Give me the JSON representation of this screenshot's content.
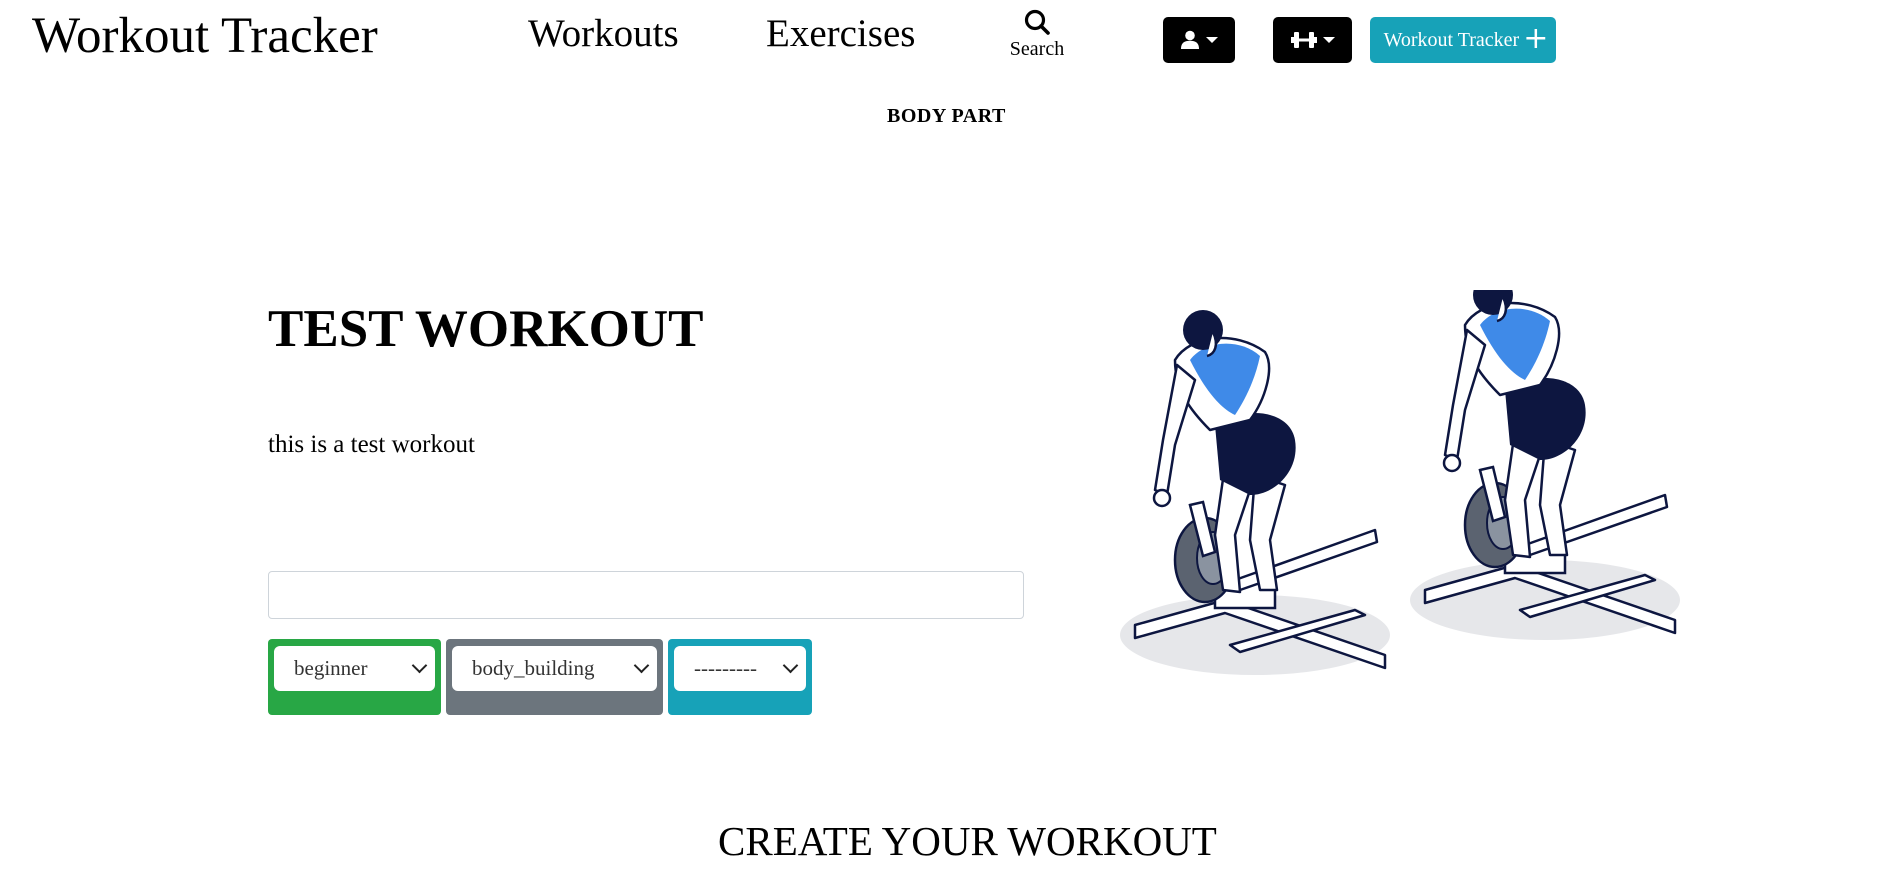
{
  "navbar": {
    "brand": "Workout Tracker",
    "links": [
      {
        "label": "Workouts"
      },
      {
        "label": "Exercises"
      }
    ],
    "search_label": "Search",
    "add_button_label": "Workout Tracker"
  },
  "sub_nav": {
    "body_part_label": "BODY PART"
  },
  "workout": {
    "title": "TEST WORKOUT",
    "description": "this is a test workout",
    "name_input_value": "",
    "difficulty_value": "beginner",
    "type_value": "body_building",
    "body_part_value": "---------"
  },
  "colors": {
    "difficulty_bg": "#28a745",
    "type_bg": "#6c757d",
    "body_part_bg": "#17a2b8",
    "accent": "#17a2b8",
    "muscle_highlight": "#3f8ae8",
    "shorts": "#0d1640"
  },
  "icons": {
    "search": "search-icon",
    "user": "user-icon",
    "dumbbell": "dumbbell-icon",
    "plus": "plus-icon"
  },
  "create_section": {
    "heading": "CREATE YOUR WORKOUT"
  }
}
